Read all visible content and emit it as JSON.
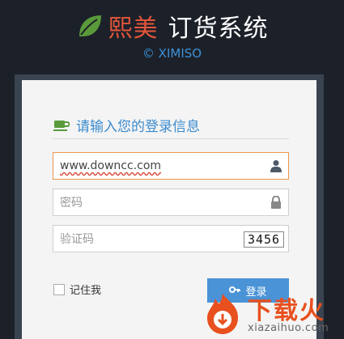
{
  "header": {
    "icon": "leaf-icon",
    "brand_name": "熙美",
    "system_name": "订货系统",
    "copyright": "© XIMISO",
    "colors": {
      "brand": "#e4553a",
      "copyright": "#3d8fd6",
      "leaf": "#5a9a3b"
    }
  },
  "login": {
    "title": "请输入您的登录信息",
    "title_icon": "cup-icon",
    "username": {
      "value": "www.downcc.com",
      "icon": "user-icon"
    },
    "password": {
      "placeholder": "密码",
      "icon": "lock-icon"
    },
    "captcha": {
      "placeholder": "验证码",
      "code": "3456"
    },
    "remember_label": "记住我",
    "submit_label": "登录",
    "submit_icon": "key-icon"
  },
  "watermark": {
    "title": "下载火",
    "subtitle": "xiazaihuo.com"
  }
}
